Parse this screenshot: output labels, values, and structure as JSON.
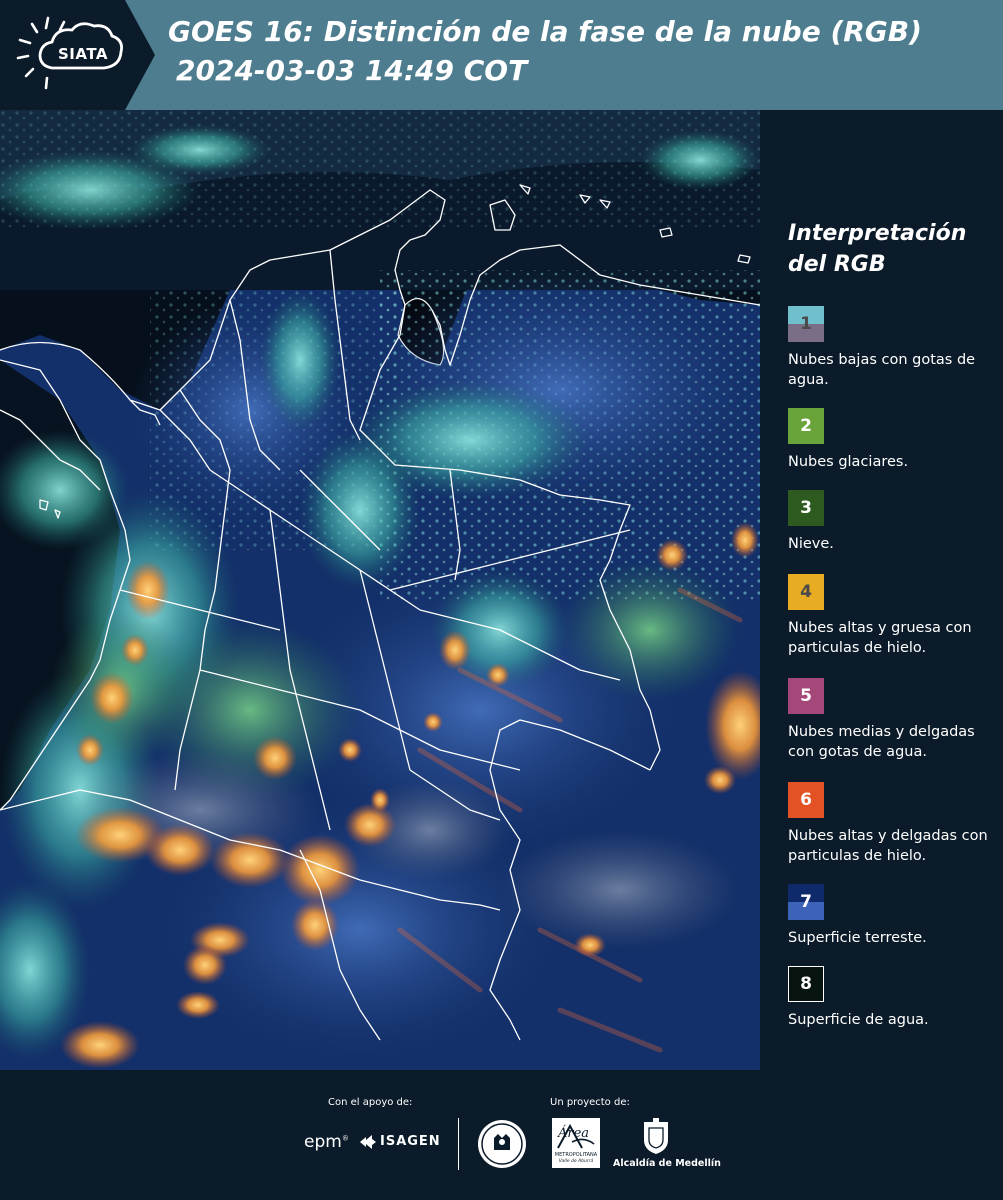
{
  "header": {
    "logo_text": "SIATA",
    "title": "GOES 16: Distinción de la fase de la nube (RGB)",
    "timestamp": "2024-03-03 14:49 COT"
  },
  "legend": {
    "title": "Interpretación del RGB",
    "items": [
      {
        "number": "1",
        "label": "Nubes bajas con gotas de agua.",
        "color_top": "#6fc0cc",
        "color_bottom": "#7a6e86",
        "number_color": "#4a4a4a"
      },
      {
        "number": "2",
        "label": "Nubes glaciares.",
        "color_top": "#6aa33a",
        "color_bottom": "#6aa33a",
        "number_color": "#ffffff"
      },
      {
        "number": "3",
        "label": "Nieve.",
        "color_top": "#2c5a1f",
        "color_bottom": "#2c5a1f",
        "number_color": "#ffffff"
      },
      {
        "number": "4",
        "label": "Nubes altas y gruesa con particulas de hielo.",
        "color_top": "#e7ac22",
        "color_bottom": "#e7ac22",
        "number_color": "#4a4a4a"
      },
      {
        "number": "5",
        "label": "Nubes medias y delgadas con gotas de agua.",
        "color_top": "#a4487a",
        "color_bottom": "#a4487a",
        "number_color": "#ffffff"
      },
      {
        "number": "6",
        "label": "Nubes altas y delgadas con particulas de hielo.",
        "color_top": "#e25225",
        "color_bottom": "#e25225",
        "number_color": "#ffffff"
      },
      {
        "number": "7",
        "label": "Superficie terreste.",
        "color_top": "#0e2a6a",
        "color_bottom": "#3d63b8",
        "number_color": "#ffffff"
      },
      {
        "number": "8",
        "label": "Superficie de agua.",
        "color_top": "#071410",
        "color_bottom": "#071410",
        "number_color": "#ffffff"
      }
    ]
  },
  "footer": {
    "support_label": "Con el apoyo de:",
    "project_label": "Un proyecto de:",
    "sponsor_epm": "epm",
    "sponsor_isagen": "ISAGEN",
    "area_logo_text": "Área",
    "area_logo_sub": "METROPOLITANA",
    "area_logo_sub2": "Valle de Aburrá",
    "alcaldia_label": "Alcaldía de Medellín"
  },
  "colors": {
    "header_bg": "#4e7d8f",
    "panel_bg": "#0b1b29",
    "logo_bg": "#0b1b29"
  },
  "map": {
    "description_icon": "satellite-image"
  }
}
